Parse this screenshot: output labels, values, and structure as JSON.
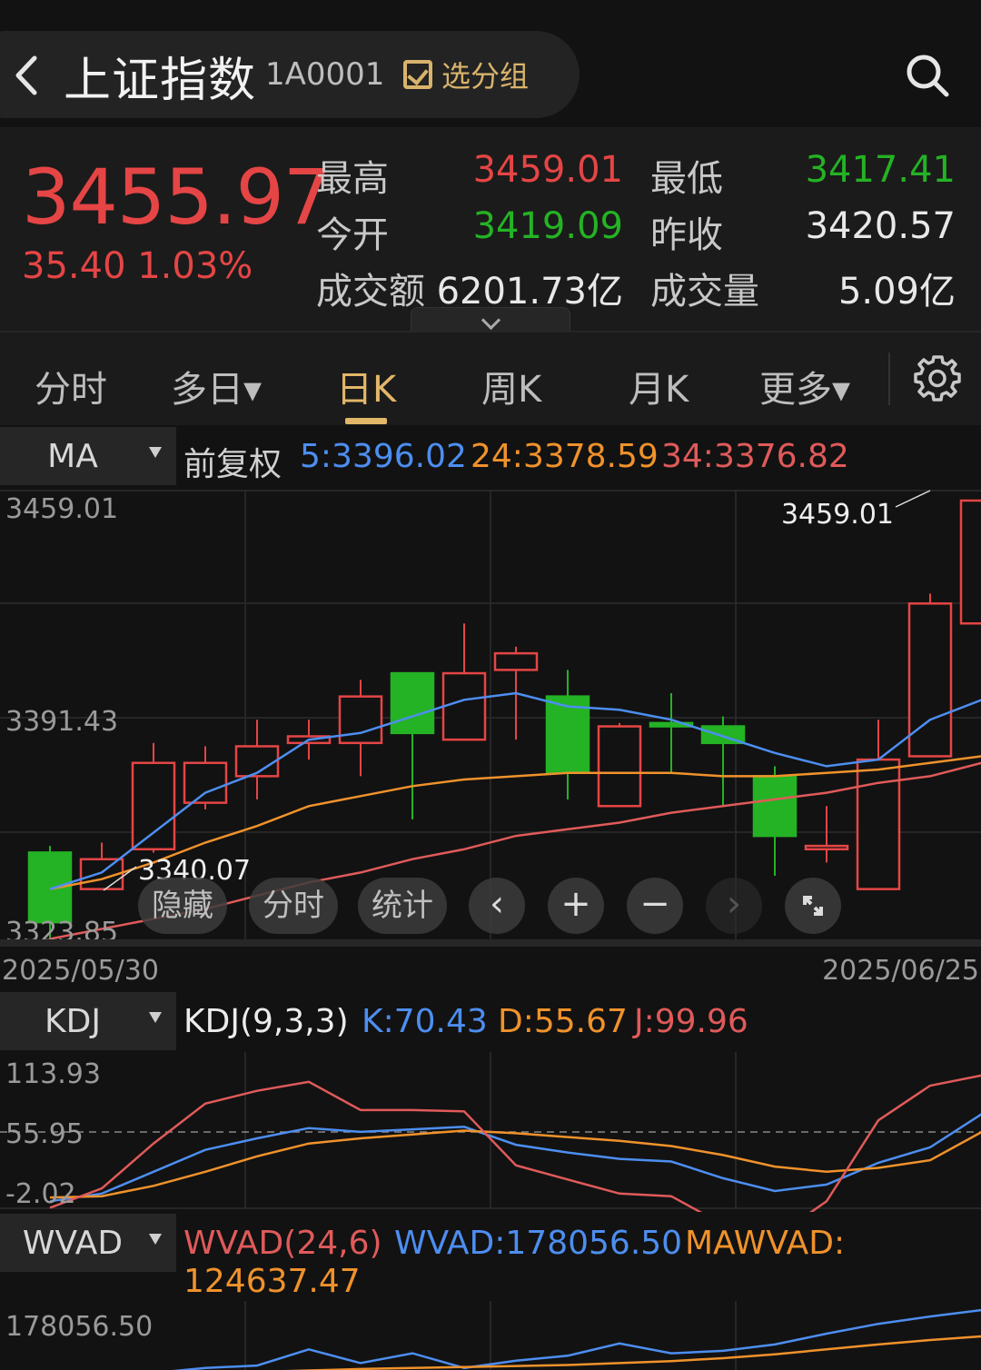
{
  "header": {
    "title": "上证指数",
    "code": "1A0001",
    "group_label": "选分组"
  },
  "quote": {
    "price": "3455.97",
    "change": "35.40 1.03%",
    "high_label": "最高",
    "high": "3459.01",
    "low_label": "最低",
    "low": "3417.41",
    "open_label": "今开",
    "open": "3419.09",
    "prev_close_label": "昨收",
    "prev_close": "3420.57",
    "turnover_label": "成交额",
    "turnover": "6201.73亿",
    "volume_label": "成交量",
    "volume": "5.09亿"
  },
  "tabs": [
    {
      "label": "分时"
    },
    {
      "label": "多日▾"
    },
    {
      "label": "日K",
      "active": true
    },
    {
      "label": "周K"
    },
    {
      "label": "月K"
    },
    {
      "label": "更多▾"
    }
  ],
  "ma_bar": {
    "selector": "MA",
    "adjust": "前复权",
    "ma5": "5:3396.02",
    "ma24": "24:3378.59",
    "ma34": "34:3376.82"
  },
  "kline_overlay": {
    "hide": "隐藏",
    "intraday": "分时",
    "stats": "统计"
  },
  "kdj_bar": {
    "selector": "KDJ",
    "name": "KDJ(9,3,3)",
    "k": "K:70.43",
    "d": "D:55.67",
    "j": "J:99.96"
  },
  "wvad_bar": {
    "selector": "WVAD",
    "name": "WVAD(24,6)",
    "wvad": "WVAD:178056.50",
    "mawvad_label": "MAWVAD:",
    "mawvad": "124637.47"
  },
  "colors": {
    "up": "#e54545",
    "down": "#24b324",
    "accent": "#e2b769",
    "ma5": "#4d8ef0",
    "ma24": "#f0922b",
    "ma34": "#e05a5a"
  },
  "chart_data": [
    {
      "type": "candlestick",
      "y_ticks": [
        "3459.01",
        "3391.43",
        "3323.85"
      ],
      "x_labels": [
        "2025/05/30",
        "2025/06/25"
      ],
      "max_label": "3459.01",
      "min_label": "3340.07",
      "candles": [
        {
          "o": 3350,
          "c": 3329,
          "h": 3352,
          "l": 3323
        },
        {
          "o": 3339,
          "c": 3348,
          "h": 3353,
          "l": 3339
        },
        {
          "o": 3351,
          "c": 3377,
          "h": 3383,
          "l": 3350
        },
        {
          "o": 3365,
          "c": 3377,
          "h": 3382,
          "l": 3363
        },
        {
          "o": 3373,
          "c": 3382,
          "h": 3390,
          "l": 3366
        },
        {
          "o": 3383,
          "c": 3385,
          "h": 3390,
          "l": 3378
        },
        {
          "o": 3383,
          "c": 3397,
          "h": 3402,
          "l": 3373
        },
        {
          "o": 3404,
          "c": 3386,
          "h": 3403,
          "l": 3360
        },
        {
          "o": 3384,
          "c": 3404,
          "h": 3419,
          "l": 3384
        },
        {
          "o": 3405,
          "c": 3410,
          "h": 3412,
          "l": 3384
        },
        {
          "o": 3397,
          "c": 3374,
          "h": 3405,
          "l": 3366
        },
        {
          "o": 3364,
          "c": 3388,
          "h": 3389,
          "l": 3364
        },
        {
          "o": 3389,
          "c": 3388,
          "h": 3398,
          "l": 3374
        },
        {
          "o": 3388,
          "c": 3383,
          "h": 3391,
          "l": 3364
        },
        {
          "o": 3373,
          "c": 3355,
          "h": 3376,
          "l": 3343
        },
        {
          "o": 3351,
          "c": 3352,
          "h": 3364,
          "l": 3347
        },
        {
          "o": 3339,
          "c": 3378,
          "h": 3390,
          "l": 3339
        },
        {
          "o": 3379,
          "c": 3425,
          "h": 3428,
          "l": 3379
        },
        {
          "o": 3419,
          "c": 3456,
          "h": 3459,
          "l": 3417
        }
      ],
      "ma5": [
        3339,
        3344,
        3356,
        3368,
        3374,
        3384,
        3386,
        3391,
        3396,
        3398,
        3394,
        3393,
        3390,
        3385,
        3380,
        3376,
        3378,
        3390,
        3396
      ],
      "ma24": [
        3339,
        3342,
        3347,
        3353,
        3358,
        3364,
        3367,
        3370,
        3372,
        3373,
        3374,
        3374,
        3374,
        3373,
        3373,
        3374,
        3375,
        3377,
        3379
      ],
      "ma34": [
        3324,
        3327,
        3330,
        3333,
        3337,
        3341,
        3344,
        3348,
        3351,
        3355,
        3357,
        3359,
        3362,
        3364,
        3366,
        3368,
        3371,
        3373,
        3377
      ]
    },
    {
      "type": "line",
      "name": "KDJ",
      "y_ticks": [
        "113.93",
        "55.95",
        "-2.02"
      ],
      "ylim": [
        -2.02,
        113.93
      ],
      "series": [
        {
          "name": "K",
          "values": [
            2,
            8,
            25,
            42,
            51,
            59,
            56,
            58,
            60,
            46,
            40,
            35,
            33,
            20,
            10,
            15,
            32,
            44,
            70
          ]
        },
        {
          "name": "D",
          "values": [
            5,
            6,
            14,
            25,
            37,
            47,
            51,
            54,
            57,
            55,
            52,
            49,
            45,
            38,
            29,
            25,
            28,
            34,
            56
          ]
        },
        {
          "name": "J",
          "values": [
            -3,
            12,
            47,
            78,
            88,
            95,
            73,
            73,
            72,
            30,
            19,
            8,
            6,
            -16,
            -26,
            2,
            65,
            92,
            100
          ]
        }
      ]
    },
    {
      "type": "line",
      "name": "WVAD",
      "y_ticks": [
        "178056.50"
      ],
      "series": [
        {
          "name": "WVAD",
          "values": [
            40000,
            45000,
            50000,
            60000,
            65000,
            98000,
            70000,
            90000,
            60000,
            75000,
            85000,
            110000,
            90000,
            95000,
            108000,
            130000,
            150000,
            165000,
            178056.5
          ]
        },
        {
          "name": "MAWVAD",
          "values": [
            45000,
            47000,
            48000,
            50000,
            52000,
            55000,
            58000,
            60000,
            62000,
            64000,
            66000,
            70000,
            74000,
            80000,
            88000,
            98000,
            108000,
            117000,
            124637.47
          ]
        }
      ]
    }
  ]
}
